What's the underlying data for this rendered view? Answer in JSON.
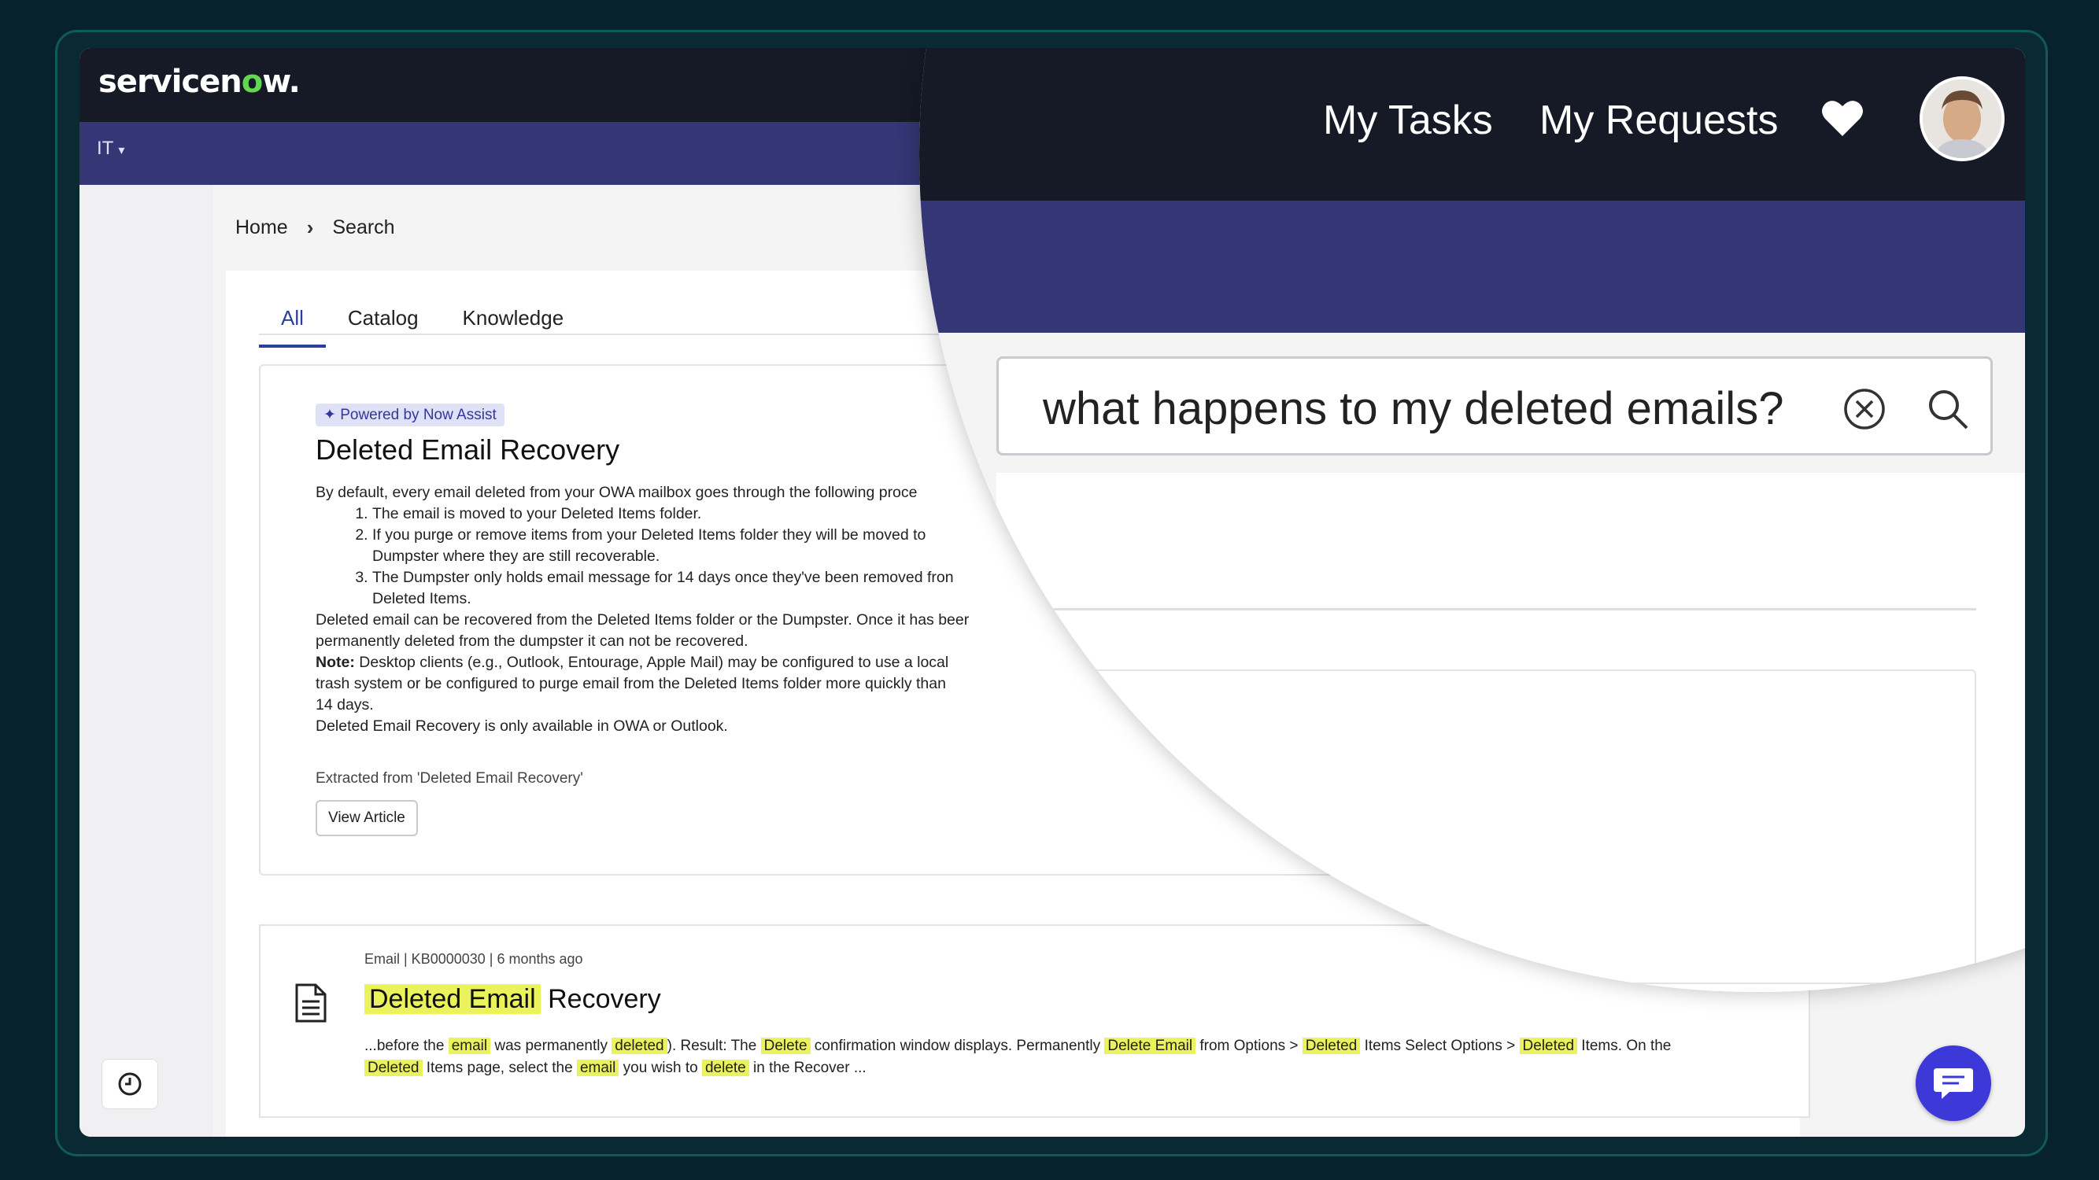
{
  "app": {
    "logo_text_a": "servicen",
    "logo_text_o": "o",
    "logo_text_b": "w.",
    "portal_menu": "IT"
  },
  "header": {
    "my_tasks": "My Tasks",
    "my_requests": "My Requests"
  },
  "breadcrumb": {
    "home": "Home",
    "current": "Search"
  },
  "tabs": [
    "All",
    "Catalog",
    "Knowledge"
  ],
  "search": {
    "query": "what happens to my deleted emails?"
  },
  "ai_answer": {
    "badge": "Powered by Now Assist",
    "title": "Deleted Email Recovery",
    "intro": "By default, every email deleted from your OWA mailbox goes through the following proce",
    "steps": [
      "The email is moved to your Deleted Items folder.",
      "If you purge or remove items from your Deleted Items folder they will be moved to",
      "The Dumpster only holds email message for 14 days once they've been removed fron"
    ],
    "step2_cont": "Dumpster where they are still recoverable.",
    "step3_cont": "Deleted Items.",
    "para1_a": "Deleted email can be recovered from the Deleted Items folder or the Dumpster. Once it has beer",
    "para1_b": "permanently deleted from the dumpster it can not be recovered.",
    "note_label": "Note:",
    "note_a": "Desktop clients (e.g., Outlook, Entourage, Apple Mail) may be configured to use a local",
    "note_b": "trash system or be configured to purge email from the Deleted Items folder more quickly than",
    "note_c": "14 days.",
    "para2": "Deleted Email Recovery is only available in OWA or Outlook.",
    "extracted": "Extracted from 'Deleted Email Recovery'",
    "view_button": "View Article"
  },
  "result": {
    "meta": "Email | KB0000030 | 6 months ago",
    "title_highlight": "Deleted Email",
    "title_rest": "Recovery",
    "snippet": [
      {
        "t": "...before the ",
        "h": false
      },
      {
        "t": "email",
        "h": true
      },
      {
        "t": " was permanently ",
        "h": false
      },
      {
        "t": "deleted",
        "h": true
      },
      {
        "t": "). Result: The ",
        "h": false
      },
      {
        "t": "Delete",
        "h": true
      },
      {
        "t": " confirmation window displays. Permanently ",
        "h": false
      },
      {
        "t": "Delete Email",
        "h": true
      },
      {
        "t": " from Options > ",
        "h": false
      },
      {
        "t": "Deleted",
        "h": true
      },
      {
        "t": " Items Select Options > ",
        "h": false
      },
      {
        "t": "Deleted",
        "h": true
      },
      {
        "t": " Items. On the",
        "h": false
      }
    ],
    "snippet_line2": [
      {
        "t": "Deleted",
        "h": true
      },
      {
        "t": " Items page, select the ",
        "h": false
      },
      {
        "t": "email",
        "h": true
      },
      {
        "t": " you wish to ",
        "h": false
      },
      {
        "t": "delete",
        "h": true
      },
      {
        "t": " in the Recover ...",
        "h": false
      }
    ]
  },
  "colors": {
    "header": "#161a26",
    "band": "#343675",
    "brand_green": "#62d84e",
    "highlight": "#eaf25c",
    "chat": "#3d38d8"
  },
  "icons": [
    "caret-down-icon",
    "chevron-right-icon",
    "sparkle-icon",
    "document-icon",
    "history-icon",
    "chat-icon",
    "heart-icon",
    "clear-icon",
    "search-icon"
  ]
}
